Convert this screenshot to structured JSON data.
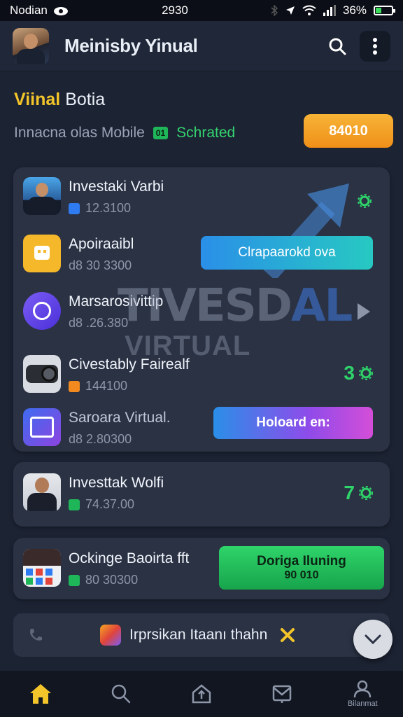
{
  "status_bar": {
    "carrier": "Nodian",
    "time": "2930",
    "battery": "36%",
    "battery_level": 0.36
  },
  "app_bar": {
    "title": "Meinisby Yinual"
  },
  "section": {
    "title_highlight": "Viinal",
    "title_rest": "Botia",
    "subtitle": "Innacna olas Mobile",
    "tag": "01",
    "status": "Schrated",
    "balance_button": "84010"
  },
  "watermark": {
    "line1_a": "TIVESD",
    "line1_b": "AL",
    "line2": "VIRTUAL"
  },
  "cards": {
    "main": [
      {
        "title": "Investaki Varbi",
        "sub": "12.3100",
        "chip_color": "#2f7cf2"
      },
      {
        "title": "Apoiraaibl",
        "sub": "d8 30 3300",
        "action": "Clrapaarokd ova"
      },
      {
        "title": "Marsarosivittip",
        "sub": "d8 .26.380"
      },
      {
        "title": "Civestably Fairealf",
        "sub": "144100",
        "value": "3",
        "chip_color": "#f28a1f"
      },
      {
        "title": "Saroara Virtual.",
        "sub": "d8 2.80300",
        "action": "Holoard en:"
      }
    ],
    "second": {
      "title": "Investtak Wolfi",
      "sub": "74.37.00",
      "value": "7",
      "chip_color": "#1fb65a"
    },
    "third": {
      "title": "Ockinge Baoirta fft",
      "sub": "80 30300",
      "action_line1": "Doriga Iluning",
      "action_line2": "90 010",
      "chip_color": "#1fb65a"
    }
  },
  "notification": {
    "text": "Irprsikan Itaanı thahn"
  },
  "bottom_nav": {
    "profile_label": "Bilanmat"
  },
  "colors": {
    "accent_yellow": "#f3c52a",
    "accent_green": "#2fd46a",
    "accent_orange": "#ef8f18",
    "background": "#1c2333",
    "card": "#2a3244"
  }
}
